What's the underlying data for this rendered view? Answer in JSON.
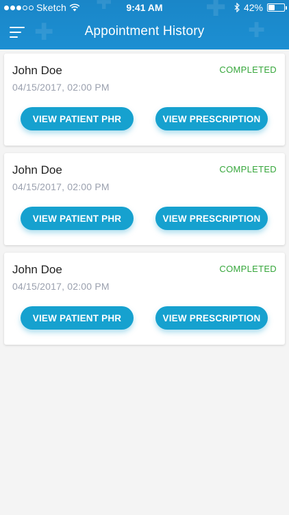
{
  "status_bar": {
    "carrier": "Sketch",
    "time": "9:41 AM",
    "battery": "42%",
    "battery_level": 0.42,
    "signal_dots": [
      true,
      true,
      true,
      false,
      false
    ]
  },
  "nav": {
    "title": "Appointment History",
    "menu_icon": "hamburger-menu-icon"
  },
  "colors": {
    "header": "#1a86c8",
    "accent_button": "#16a1cf",
    "completed": "#35a63a",
    "date_text": "#9aa0ae"
  },
  "appointments": [
    {
      "patient": "John Doe",
      "datetime": "04/15/2017, 02:00 PM",
      "status": "COMPLETED",
      "phr_label": "VIEW PATIENT PHR",
      "prescription_label": "VIEW PRESCRIPTION"
    },
    {
      "patient": "John Doe",
      "datetime": "04/15/2017, 02:00 PM",
      "status": "COMPLETED",
      "phr_label": "VIEW PATIENT PHR",
      "prescription_label": "VIEW PRESCRIPTION"
    },
    {
      "patient": "John Doe",
      "datetime": "04/15/2017, 02:00 PM",
      "status": "COMPLETED",
      "phr_label": "VIEW PATIENT PHR",
      "prescription_label": "VIEW PRESCRIPTION"
    }
  ]
}
